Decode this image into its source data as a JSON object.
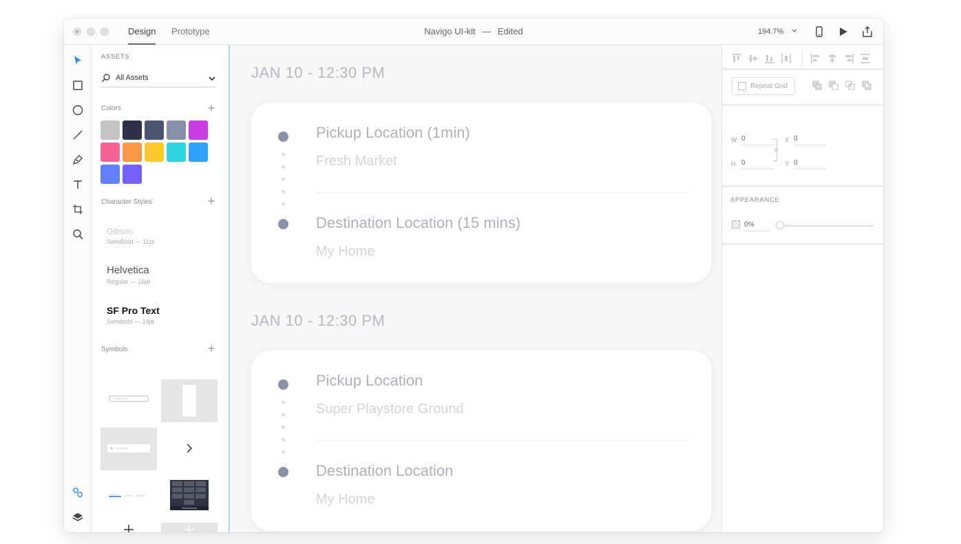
{
  "titlebar": {
    "tabs": [
      {
        "label": "Design",
        "active": true
      },
      {
        "label": "Prototype",
        "active": false
      }
    ],
    "doc_title": "Navigo UI-kit",
    "doc_separator": "—",
    "doc_status": "Edited",
    "zoom": "194.7%"
  },
  "assets": {
    "header": "ASSETS",
    "filter_label": "All Assets",
    "colors_label": "Colors",
    "colors": [
      "#c4c4c4",
      "#2d3047",
      "#4b5572",
      "#8690a9",
      "#c93ce6",
      "#f66295",
      "#fd9748",
      "#fec82d",
      "#2ed5e1",
      "#2da1fc",
      "#617ffc",
      "#7560fd"
    ],
    "character_styles_label": "Character Styles",
    "character_styles": [
      {
        "name": "Gibson",
        "meta": "SemiBold — 11pt"
      },
      {
        "name": "Helvetica",
        "meta": "Regular — 16pt"
      },
      {
        "name": "SF Pro Text",
        "meta": "Semibold — 14pt"
      }
    ],
    "symbols_label": "Symbols"
  },
  "canvas": {
    "rides": [
      {
        "date": "JAN 10 - 12:30 PM",
        "pickup_title": "Pickup Location (1min)",
        "pickup_place": "Fresh Market",
        "dest_title": "Destination Location (15 mins)",
        "dest_place": "My Home"
      },
      {
        "date": "JAN 10 - 12:30 PM",
        "pickup_title": "Pickup Location",
        "pickup_place": "Super Playstore Ground",
        "dest_title": "Destination Location",
        "dest_place": "My Home"
      }
    ]
  },
  "inspector": {
    "repeat_grid_label": "Repeat Grid",
    "w_label": "W",
    "w_value": "0",
    "h_label": "H",
    "h_value": "0",
    "x_label": "X",
    "x_value": "0",
    "y_label": "Y",
    "y_value": "0",
    "appearance_label": "APPEARANCE",
    "opacity_value": "0%"
  }
}
